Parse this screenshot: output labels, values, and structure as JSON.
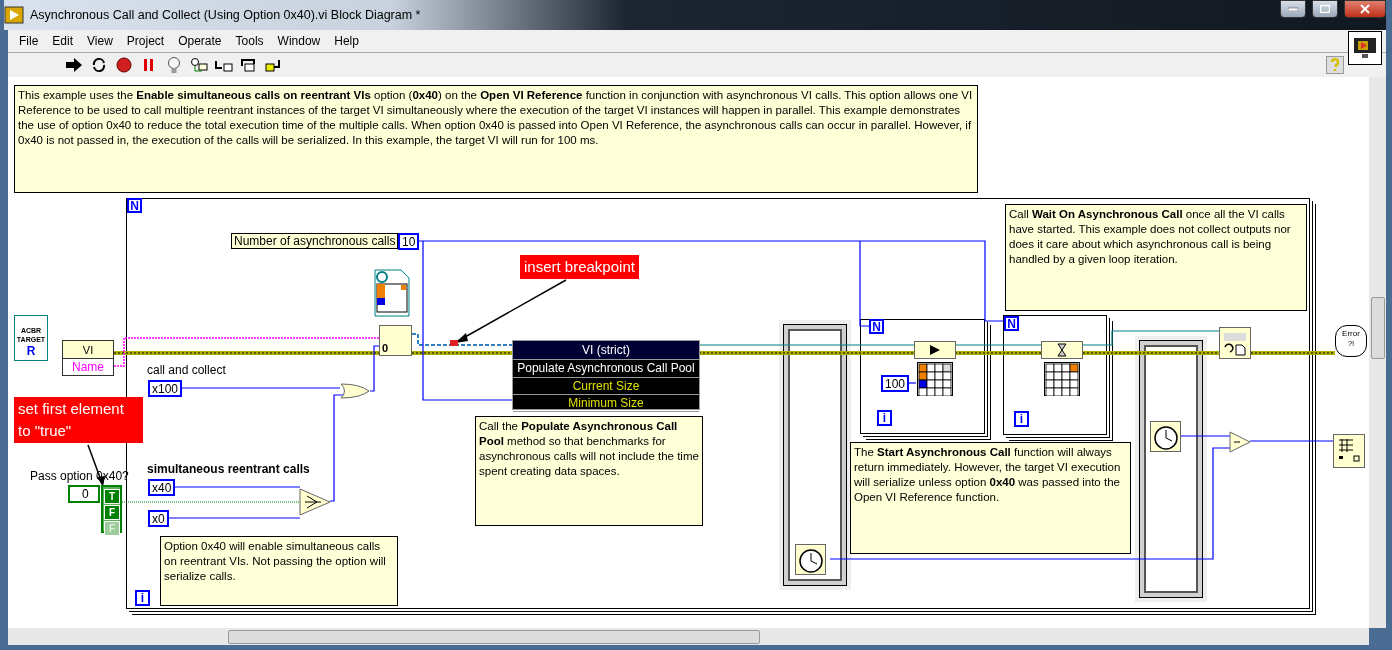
{
  "window": {
    "title": "Asynchronous Call and Collect (Using Option 0x40).vi Block Diagram *"
  },
  "menu": [
    {
      "label": "File"
    },
    {
      "label": "Edit"
    },
    {
      "label": "View"
    },
    {
      "label": "Project"
    },
    {
      "label": "Operate"
    },
    {
      "label": "Tools"
    },
    {
      "label": "Window"
    },
    {
      "label": "Help"
    }
  ],
  "diagram": {
    "description": "This example uses the **Enable simultaneous calls on reentrant VIs** option (**0x40**) on the **Open VI Reference** function in conjunction with asynchronous VI calls. This option allows one VI Reference to be used to call multiple reentrant instances of the target VI simultaneously where the execution of the target VI instances will happen in parallel. This example demonstrates the use of option 0x40 to reduce the total execution time of the multiple calls. When option 0x40 is passed into Open VI Reference, the asynchronous calls can occur in parallel. However, if 0x40 is not passed in, the execution of the calls will be serialized. In this example, the target VI will run for 100 ms.",
    "loops": [
      {
        "count": "N",
        "index": "i"
      },
      {
        "count": "N",
        "index": "i"
      },
      {
        "count": "N",
        "index": "i"
      }
    ],
    "count_label": "Number of asynchronous calls",
    "count_value": "10",
    "annotations": [
      {
        "text": "insert breakpoint"
      },
      {
        "text": "set first element to \"true\""
      }
    ],
    "target_icon": {
      "lines": [
        "ACBR",
        "TARGET"
      ],
      "letter": "R"
    },
    "open_ref": {
      "type": "VI",
      "property": "Name"
    },
    "options": [
      {
        "label": "call and collect",
        "value": "x100",
        "bold": false
      },
      {
        "label": "simultaneous reentrant calls",
        "value": "x40",
        "bold": true
      }
    ],
    "zero_constant": "x0",
    "pass_option": {
      "label": "Pass option 0x40?",
      "index": "0",
      "elements": [
        {
          "text": "T",
          "disabled": false
        },
        {
          "text": "F",
          "disabled": false
        },
        {
          "text": "F",
          "disabled": true
        }
      ]
    },
    "open_node_value": "0",
    "property_node": {
      "header": "VI (strict)",
      "method": "Populate Asynchronous Call Pool",
      "properties": [
        "Current Size",
        "Minimum Size"
      ]
    },
    "comments": [
      {
        "text": "Option 0x40 will enable simultaneous calls on reentrant VIs. Not passing the option will serialize calls."
      },
      {
        "text": "Call the **Populate Asynchronous Call Pool** method so that benchmarks for asynchronous calls will not include the time spent creating data spaces."
      },
      {
        "text": "The **Start Asynchronous Call** function will always return immediately. However, the target VI execution will serialize unless option **0x40** was passed into the Open VI Reference function."
      },
      {
        "text": "Call **Wait On Asynchronous Call** once all the VI calls have started. This example does not collect outputs nor does it care about which asynchronous call is being handled by a given loop iteration."
      }
    ],
    "delay_constant": "100",
    "error_icon": {
      "lines": [
        "Error",
        "?!"
      ]
    }
  }
}
